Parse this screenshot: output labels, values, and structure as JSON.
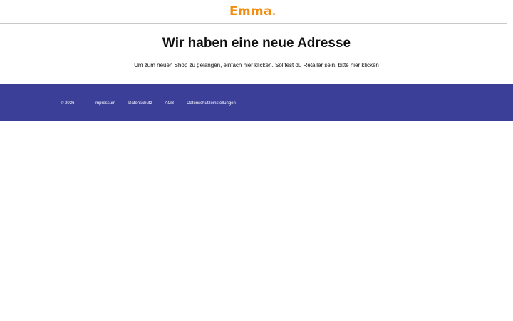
{
  "header": {
    "logo_text": "Emma",
    "brand_color": "#f28c0f",
    "divider_color": "#c9c9c9"
  },
  "main": {
    "title": "Wir haben eine neue Adresse",
    "text_part1": "Um zum neuen Shop zu gelangen, einfach ",
    "link1_label": "hier klicken",
    "text_part2": ". Solltest du Retailer sein, bitte ",
    "link2_label": "hier klicken"
  },
  "footer": {
    "background_color": "#3b3f98",
    "copyright": "© 2026",
    "links": [
      {
        "label": "Impressum"
      },
      {
        "label": "Datenschutz"
      },
      {
        "label": "AGB"
      },
      {
        "label": "Datenschutzeinstellungen"
      }
    ]
  }
}
